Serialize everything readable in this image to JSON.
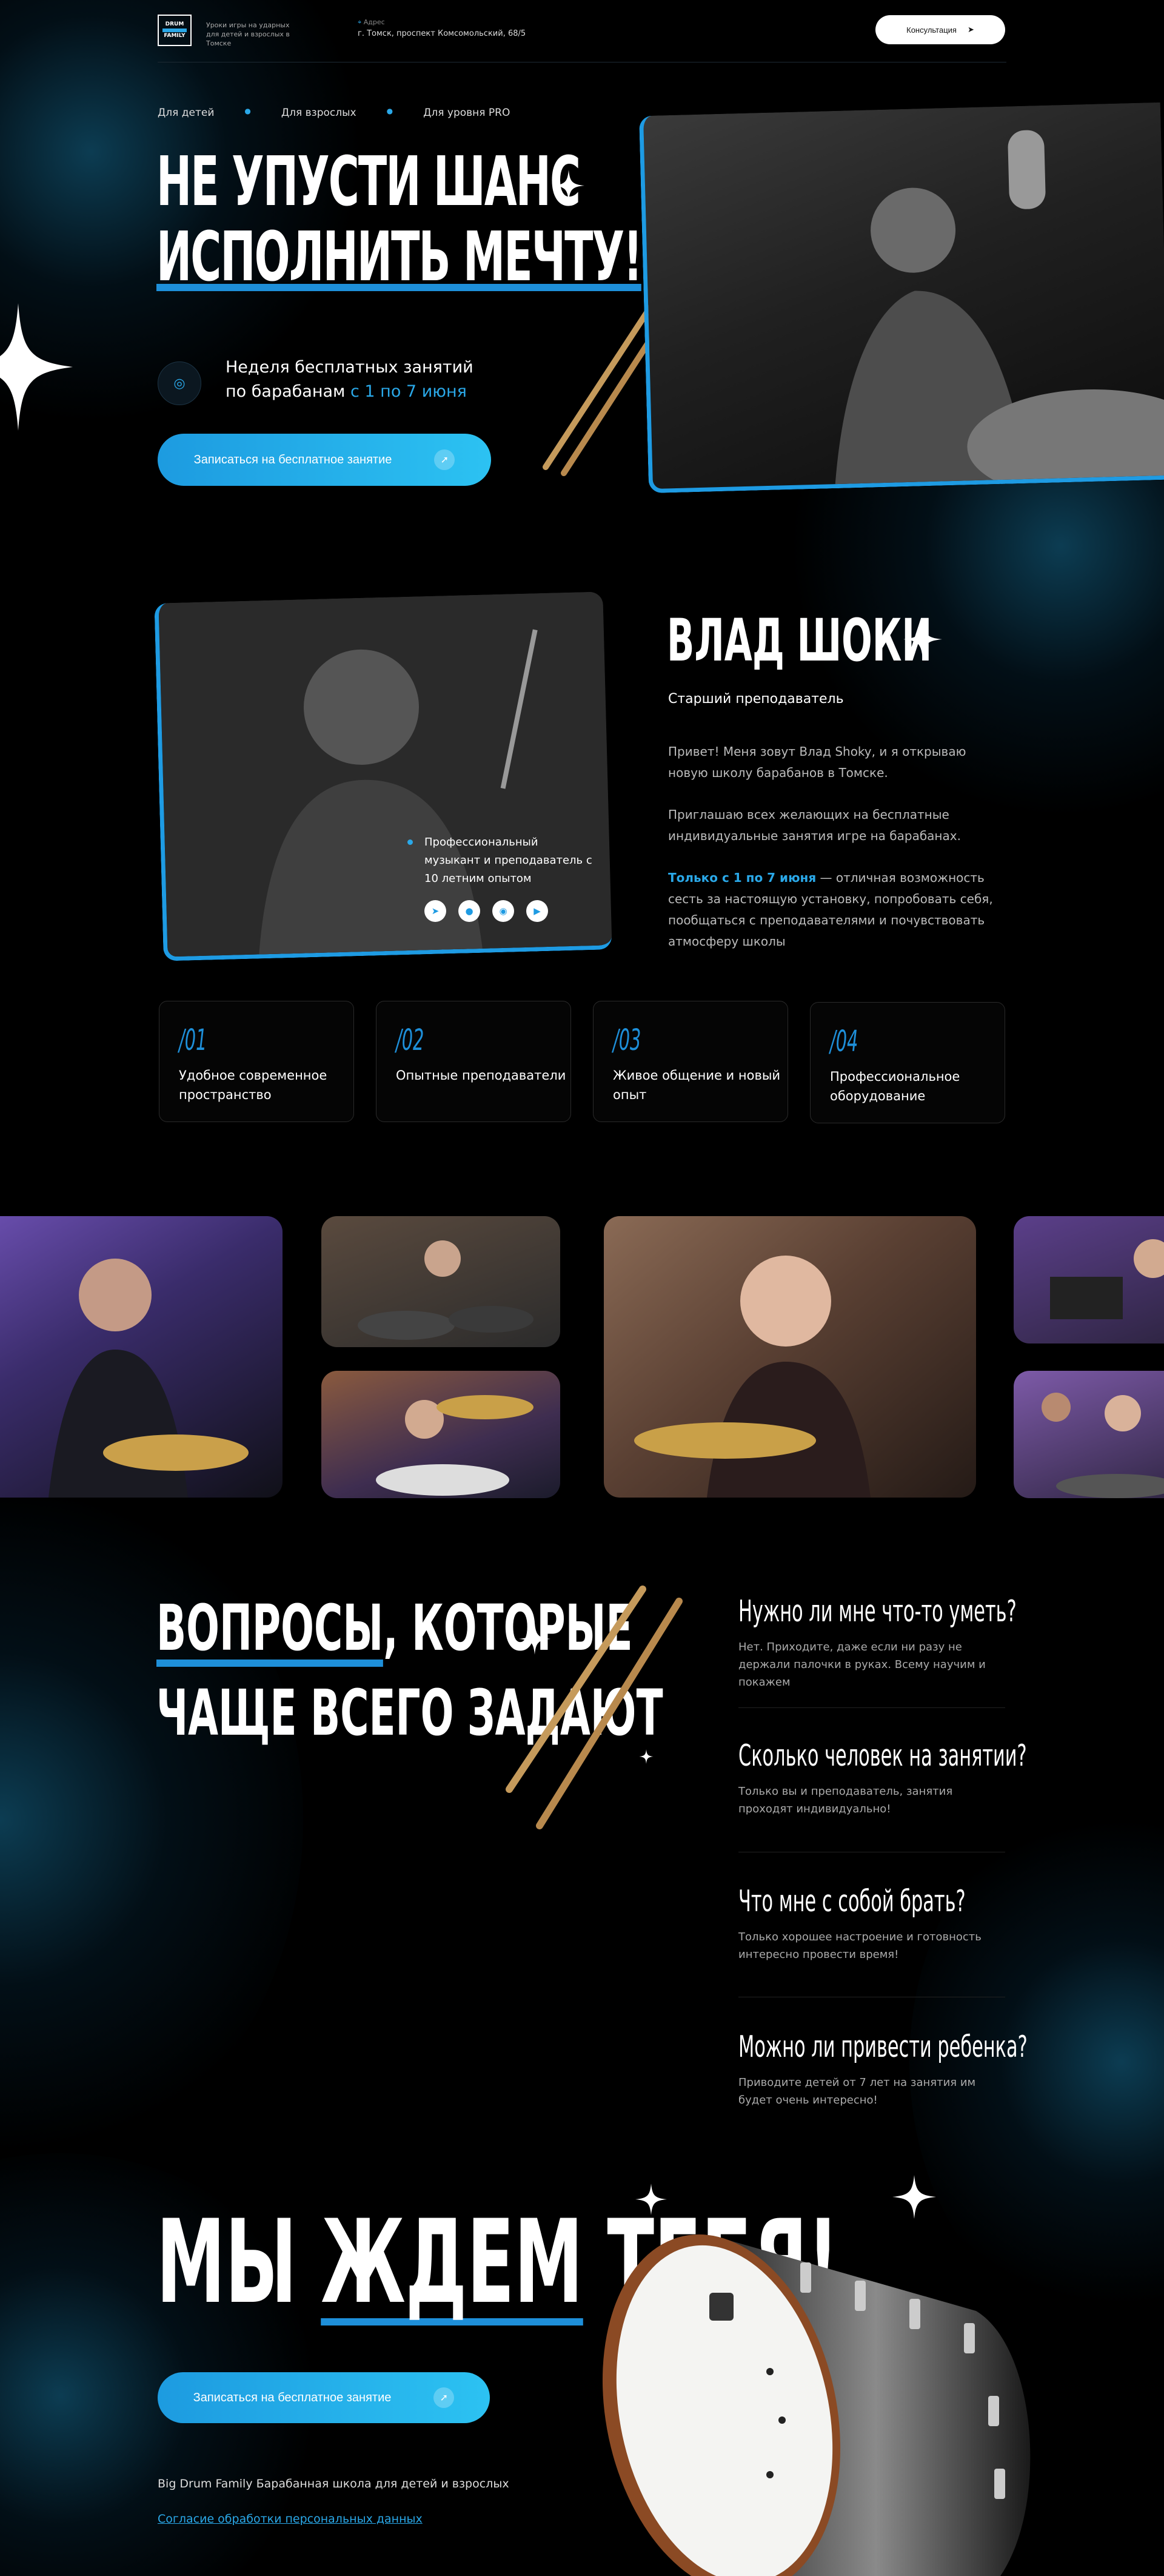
{
  "header": {
    "logo_lines": [
      "DRUM",
      "FAMILY"
    ],
    "tagline": "Уроки игры на ударных для детей и взрослых в Томске",
    "address_label": "Адрес",
    "address": "г. Томск, проспект Комсомольский, 68/5",
    "consult_label": "Консультация"
  },
  "hero": {
    "nav": [
      "Для детей",
      "Для взрослых",
      "Для уровня PRO"
    ],
    "title_line1": "НЕ УПУСТИ ШАНС",
    "title_line2": "ИСПОЛНИТЬ МЕЧТУ!",
    "week_line1": "Неделя бесплатных занятий",
    "week_line2_prefix": "по барабанам ",
    "week_line2_accent": "с 1 по 7 июня",
    "cta_label": "Записаться на бесплатное занятие"
  },
  "teacher": {
    "name": "ВЛАД ШОКИ",
    "role": "Старший преподаватель",
    "p1": "Привет! Меня зовут Влад Shoky, и я открываю новую школу барабанов в Томске.",
    "p2": "Приглашаю всех желающих на бесплатные индивидуальные занятия игре на барабанах.",
    "p3_accent": "Только с 1 по 7 июня",
    "p3_rest": " — отличная возможность сесть за настоящую установку, попробовать себя, пообщаться с преподавателями и почувствовать атмосферу школы",
    "badge": "Профессиональный музыкант и преподаватель с 10 летним опытом",
    "social_icons": [
      "telegram-icon",
      "vk-icon",
      "instagram-icon",
      "youtube-icon"
    ]
  },
  "features": [
    {
      "num": "/01",
      "text": "Удобное современное пространство"
    },
    {
      "num": "/02",
      "text": "Опытные преподаватели"
    },
    {
      "num": "/03",
      "text": "Живое общение и новый опыт"
    },
    {
      "num": "/04",
      "text": "Профессиональное оборудование"
    }
  ],
  "faq": {
    "title_line1_under": "ВОПРОСЫ",
    "title_line1_rest": ", КОТОРЫЕ",
    "title_line2": "ЧАЩЕ ВСЕГО ЗАДАЮТ",
    "items": [
      {
        "q": "Нужно ли мне что-то уметь?",
        "a": "Нет. Приходите, даже если ни разу не держали палочки в руках. Всему научим и покажем"
      },
      {
        "q": "Сколько человек на занятии?",
        "a": "Только вы и преподаватель, занятия проходят индивидуально!"
      },
      {
        "q": "Что мне с собой брать?",
        "a": "Только хорошее настроение и готовность интересно провести время!"
      },
      {
        "q": "Можно ли привести ребенка?",
        "a": "Приводите детей от 7 лет на занятия им будет очень интересно!"
      }
    ]
  },
  "final": {
    "title_a": "МЫ ",
    "title_under": "ЖДЕМ",
    "title_b": " ТЕБЯ!",
    "cta_label": "Записаться на бесплатное занятие",
    "footer_text": "Big Drum Family Барабанная школа для детей и взрослых",
    "privacy_link": "Согласие обработки персональных данных"
  },
  "colors": {
    "accent": "#2aa8e8",
    "background": "#000000"
  }
}
